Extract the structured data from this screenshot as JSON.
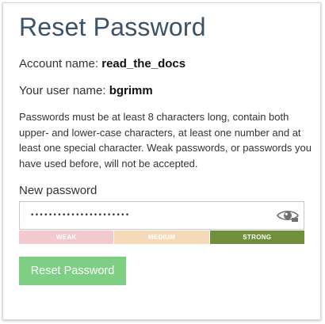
{
  "page": {
    "title": "Reset Password"
  },
  "account": {
    "label": "Account name:",
    "value": "read_the_docs"
  },
  "user": {
    "label": "Your user name:",
    "value": "bgrimm"
  },
  "rules_text": "Passwords must be at least 8 characters long, contain both upper- and lower-case characters, at least one number and at least one special character. Weak passwords, or passwords you have used before, will not be accepted.",
  "new_password": {
    "label": "New password",
    "value": "••••••••••••••••••••••",
    "show_icon": "eye-icon"
  },
  "strength": {
    "levels": [
      "WEAK",
      "MEDIUM",
      "STRONG"
    ],
    "current": "STRONG",
    "colors": {
      "weak": "#f2c9cc",
      "medium": "#f6d9b9",
      "strong": "#718f3a"
    }
  },
  "actions": {
    "reset_label": "Reset Password",
    "reset_color": "#7ecf83"
  }
}
